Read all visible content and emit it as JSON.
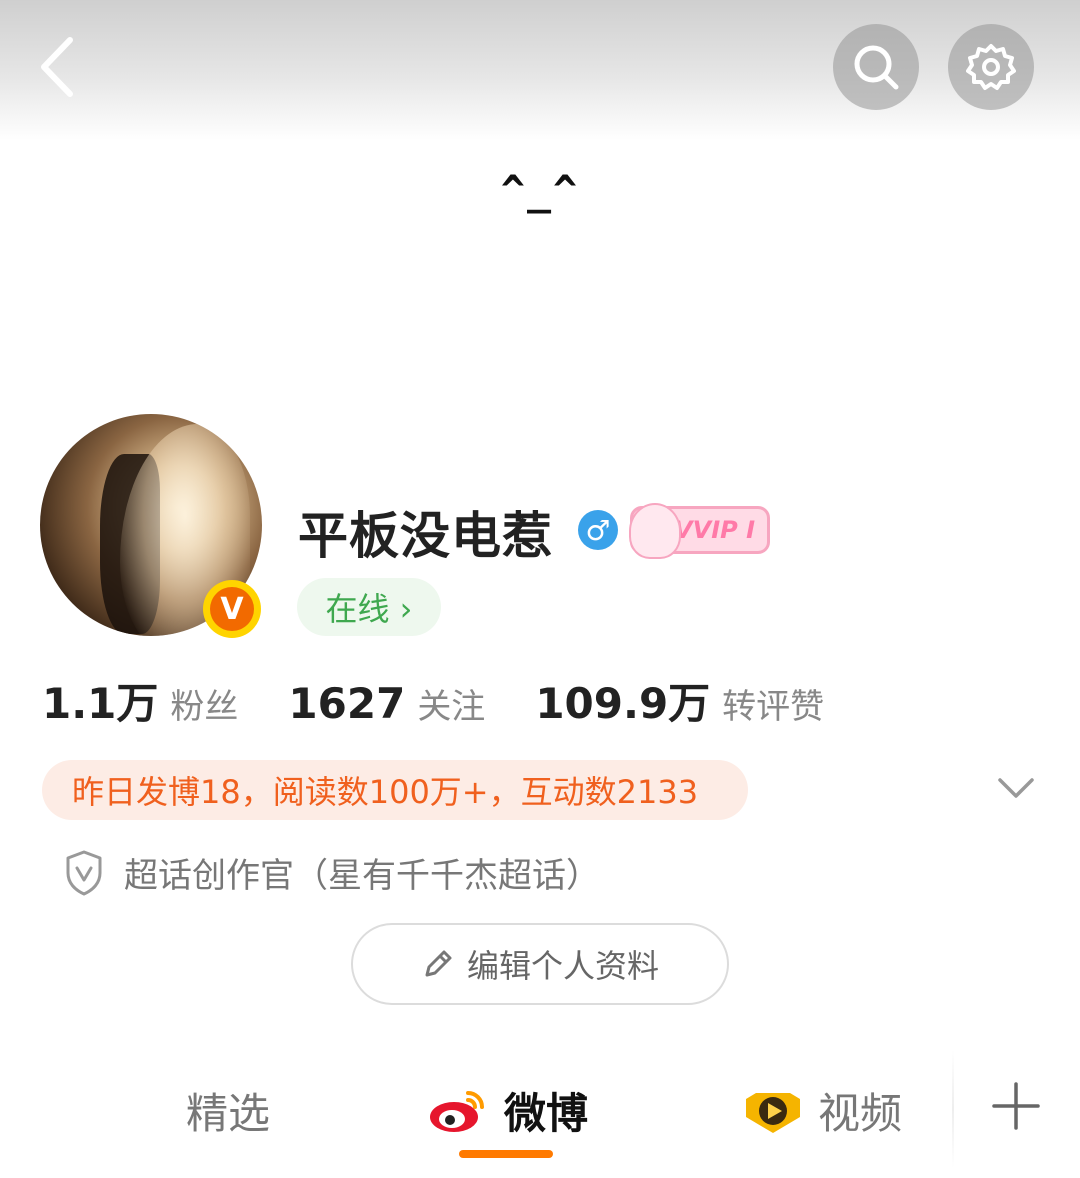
{
  "header": {
    "title": "^_^",
    "back_icon": "chevron-left-icon",
    "search_icon": "search-icon",
    "settings_icon": "gear-icon"
  },
  "profile": {
    "name": "平板没电惹",
    "gender_symbol": "♂",
    "vip_badge": "VVIP I",
    "verified_badge": "V",
    "online_label": "在线 ›",
    "colors": {
      "accent": "#ff7a00",
      "online_green": "#3fa84f",
      "gender_blue": "#3aa2ea"
    }
  },
  "stats": [
    {
      "value": "1.1万",
      "label": "粉丝"
    },
    {
      "value": "1627",
      "label": "关注"
    },
    {
      "value": "109.9万",
      "label": "转评赞"
    }
  ],
  "activity_summary": "昨日发博18，阅读数100万+，互动数2133",
  "title_badge": "超话创作官（星有千千杰超话）",
  "edit_profile_label": "编辑个人资料",
  "tabs": [
    {
      "label": "精选",
      "icon": ""
    },
    {
      "label": "微博",
      "icon": "weibo-logo-icon",
      "active": true
    },
    {
      "label": "视频",
      "icon": "video-play-icon"
    }
  ],
  "add_tab_icon": "plus-icon"
}
